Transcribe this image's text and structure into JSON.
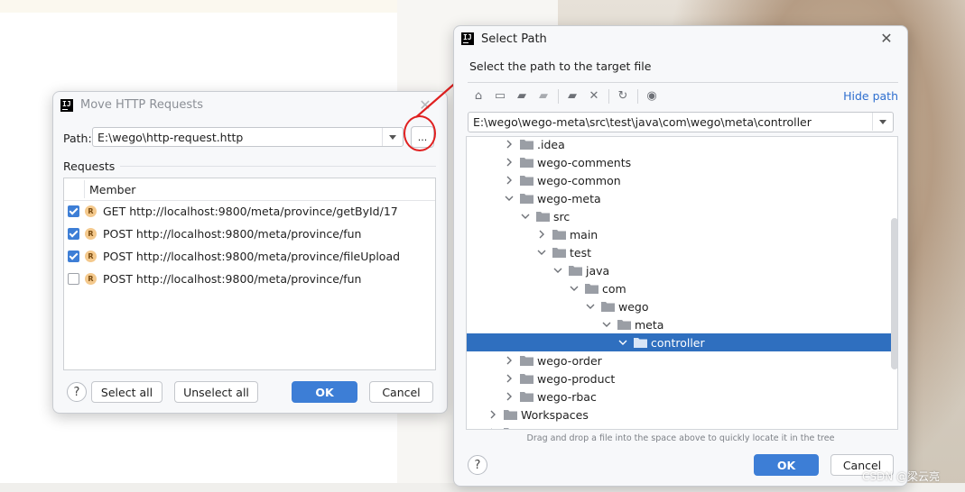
{
  "move_dialog": {
    "title": "Move HTTP Requests",
    "path_label": "Path:",
    "path_value": "E:\\wego\\http-request.http",
    "browse_label": "...",
    "requests_label": "Requests",
    "column_header": "Member",
    "rows": [
      {
        "checked": true,
        "badge": "R",
        "text": "GET http://localhost:9800/meta/province/getById/17"
      },
      {
        "checked": true,
        "badge": "R",
        "text": "POST http://localhost:9800/meta/province/fun"
      },
      {
        "checked": true,
        "badge": "R",
        "text": "POST http://localhost:9800/meta/province/fileUpload"
      },
      {
        "checked": false,
        "badge": "R",
        "text": "POST http://localhost:9800/meta/province/fun"
      }
    ],
    "help": "?",
    "select_all": "Select all",
    "unselect_all": "Unselect all",
    "ok": "OK",
    "cancel": "Cancel"
  },
  "select_dialog": {
    "title": "Select Path",
    "subtitle": "Select the path to the target file",
    "hide_path": "Hide path",
    "path_value": "E:\\wego\\wego-meta\\src\\test\\java\\com\\wego\\meta\\controller",
    "toolbar_icons": [
      "home-icon",
      "desktop-icon",
      "project-folder-icon",
      "module-folder-icon",
      "new-folder-icon",
      "delete-icon",
      "refresh-icon",
      "show-hidden-icon"
    ],
    "tree": [
      {
        "name": ".idea",
        "depth": 2,
        "expanded": false
      },
      {
        "name": "wego-comments",
        "depth": 2,
        "expanded": false
      },
      {
        "name": "wego-common",
        "depth": 2,
        "expanded": false
      },
      {
        "name": "wego-meta",
        "depth": 2,
        "expanded": true
      },
      {
        "name": "src",
        "depth": 3,
        "expanded": true
      },
      {
        "name": "main",
        "depth": 4,
        "expanded": false
      },
      {
        "name": "test",
        "depth": 4,
        "expanded": true
      },
      {
        "name": "java",
        "depth": 5,
        "expanded": true
      },
      {
        "name": "com",
        "depth": 6,
        "expanded": true
      },
      {
        "name": "wego",
        "depth": 7,
        "expanded": true
      },
      {
        "name": "meta",
        "depth": 8,
        "expanded": true
      },
      {
        "name": "controller",
        "depth": 9,
        "expanded": true,
        "selected": true
      },
      {
        "name": "wego-order",
        "depth": 2,
        "expanded": false
      },
      {
        "name": "wego-product",
        "depth": 2,
        "expanded": false
      },
      {
        "name": "wego-rbac",
        "depth": 2,
        "expanded": false
      },
      {
        "name": "Workspaces",
        "depth": 1,
        "expanded": false
      },
      {
        "name": "下载",
        "depth": 1,
        "expanded": false
      }
    ],
    "hint": "Drag and drop a file into the space above to quickly locate it in the tree",
    "help": "?",
    "ok": "OK",
    "cancel": "Cancel"
  },
  "watermark": "CSDN @梁云亮",
  "colors": {
    "accent": "#3d7ed6",
    "selection": "#2f6fbf",
    "annotation_red": "#e02020",
    "link": "#2f6fcf"
  }
}
